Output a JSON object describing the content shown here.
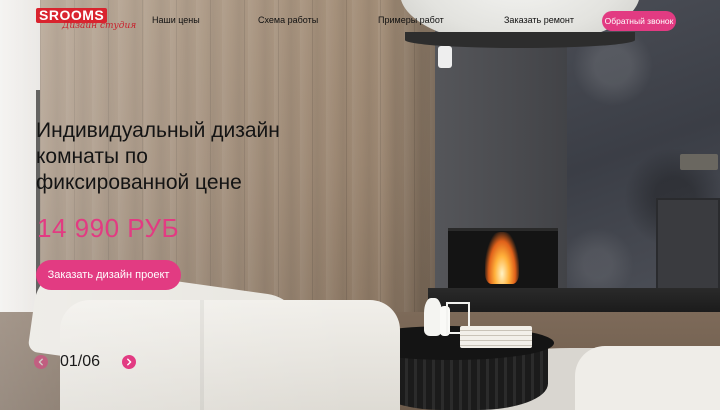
{
  "header": {
    "logo_text": "SROOMS",
    "logo_tagline": "Дизайн студия",
    "nav": [
      {
        "label": "Наши цены"
      },
      {
        "label": "Схема работы"
      },
      {
        "label": "Примеры работ"
      },
      {
        "label": "Заказать ремонт"
      }
    ],
    "callback_label": "Обратный звонок"
  },
  "hero": {
    "title": "Индивидуальный дизайн комнаты по фиксированной цене",
    "price": "14 990 РУБ",
    "cta_label": "Заказать дизайн проект"
  },
  "slider": {
    "current": "01",
    "separator": "/",
    "total": "06",
    "prev_icon": "chevron-left-icon",
    "next_icon": "chevron-right-icon"
  },
  "colors": {
    "accent": "#e23b82",
    "logo_red": "#d9232e",
    "text": "#141414"
  }
}
